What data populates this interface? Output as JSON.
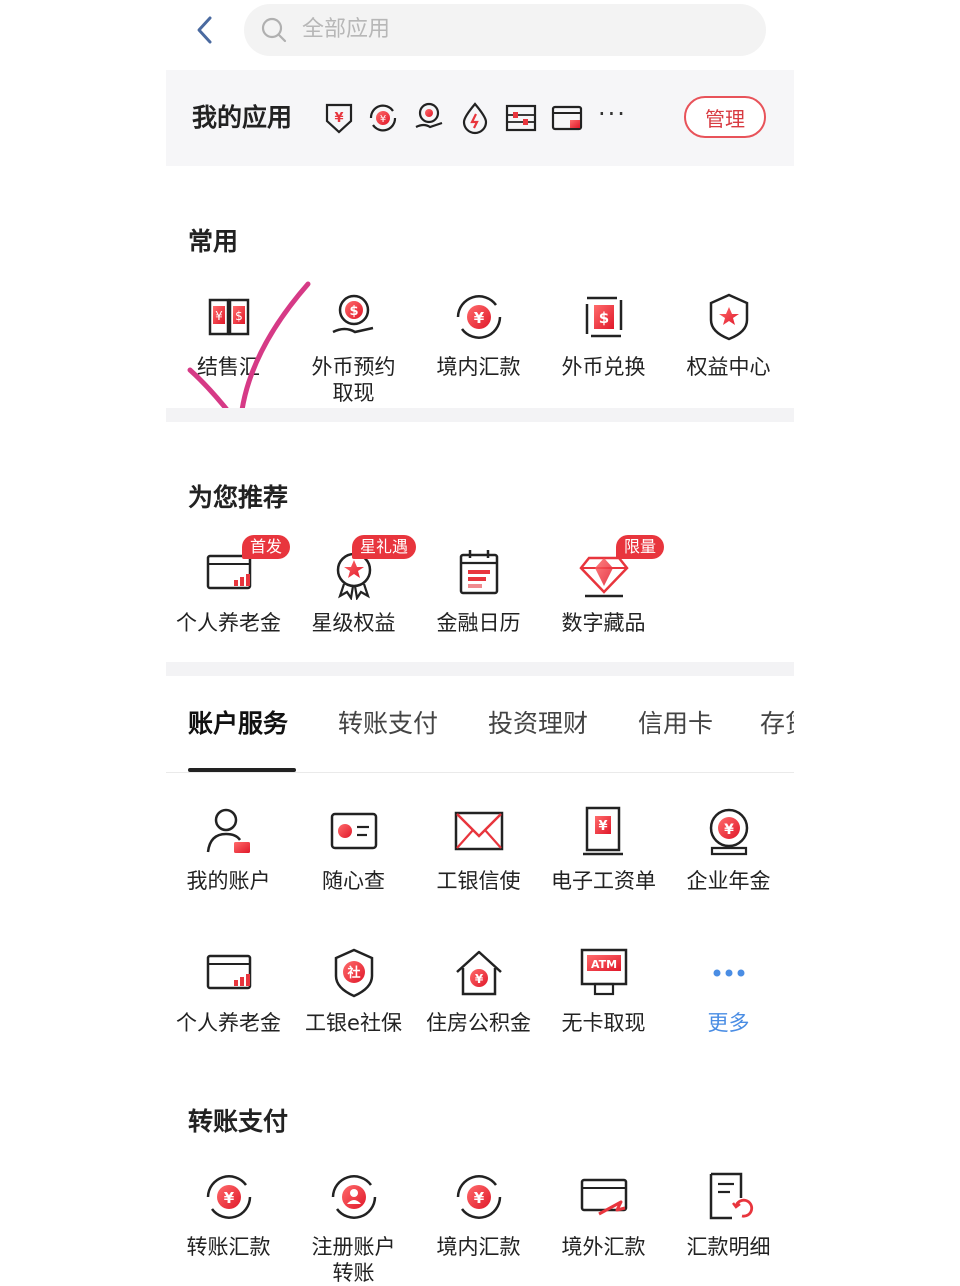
{
  "search": {
    "placeholder": "全部应用"
  },
  "my_apps": {
    "title": "我的应用",
    "icons": [
      "yuan-shield-icon",
      "yuan-exchange-icon",
      "hand-coin-icon",
      "water-drop-icon",
      "abacus-icon",
      "card-icon"
    ],
    "more": "···",
    "manage_label": "管理"
  },
  "common": {
    "title": "常用",
    "items": [
      {
        "label": "结售汇",
        "icon": "currency-exchange-icon"
      },
      {
        "label": "外币预约\n取现",
        "icon": "dollar-hand-icon"
      },
      {
        "label": "境内汇款",
        "icon": "yuan-transfer-icon"
      },
      {
        "label": "外币兑换",
        "icon": "dollar-exchange-icon"
      },
      {
        "label": "权益中心",
        "icon": "star-shield-icon"
      }
    ]
  },
  "recommend": {
    "title": "为您推荐",
    "items": [
      {
        "label": "个人养老金",
        "badge": "首发",
        "icon": "pension-card-icon"
      },
      {
        "label": "星级权益",
        "badge": "星礼遇",
        "icon": "star-medal-icon"
      },
      {
        "label": "金融日历",
        "badge": "",
        "icon": "calendar-icon"
      },
      {
        "label": "数字藏品",
        "badge": "限量",
        "icon": "diamond-icon"
      }
    ]
  },
  "tabs": [
    "账户服务",
    "转账支付",
    "投资理财",
    "信用卡",
    "存贷"
  ],
  "account_services": {
    "row1": [
      {
        "label": "我的账户",
        "icon": "user-card-icon"
      },
      {
        "label": "随心查",
        "icon": "id-card-icon"
      },
      {
        "label": "工银信使",
        "icon": "envelope-icon"
      },
      {
        "label": "电子工资单",
        "icon": "payslip-icon"
      },
      {
        "label": "企业年金",
        "icon": "yuan-globe-icon"
      }
    ],
    "row2": [
      {
        "label": "个人养老金",
        "icon": "pension-card-icon"
      },
      {
        "label": "工银e社保",
        "icon": "social-security-shield-icon"
      },
      {
        "label": "住房公积金",
        "icon": "house-yuan-icon"
      },
      {
        "label": "无卡取现",
        "icon": "atm-icon"
      },
      {
        "label": "更多",
        "icon": "more-dots-icon"
      }
    ]
  },
  "transfer": {
    "title": "转账支付",
    "items": [
      {
        "label": "转账汇款",
        "icon": "yuan-transfer-icon"
      },
      {
        "label": "注册账户\n转账",
        "icon": "user-transfer-icon"
      },
      {
        "label": "境内汇款",
        "icon": "yuan-transfer-icon"
      },
      {
        "label": "境外汇款",
        "icon": "card-send-icon"
      },
      {
        "label": "汇款明细",
        "icon": "receipt-refresh-icon"
      }
    ]
  },
  "colors": {
    "accent": "#e8353d",
    "manage_border": "#e8535a",
    "more_blue": "#4a8de4",
    "check_mark": "#d63a86"
  }
}
